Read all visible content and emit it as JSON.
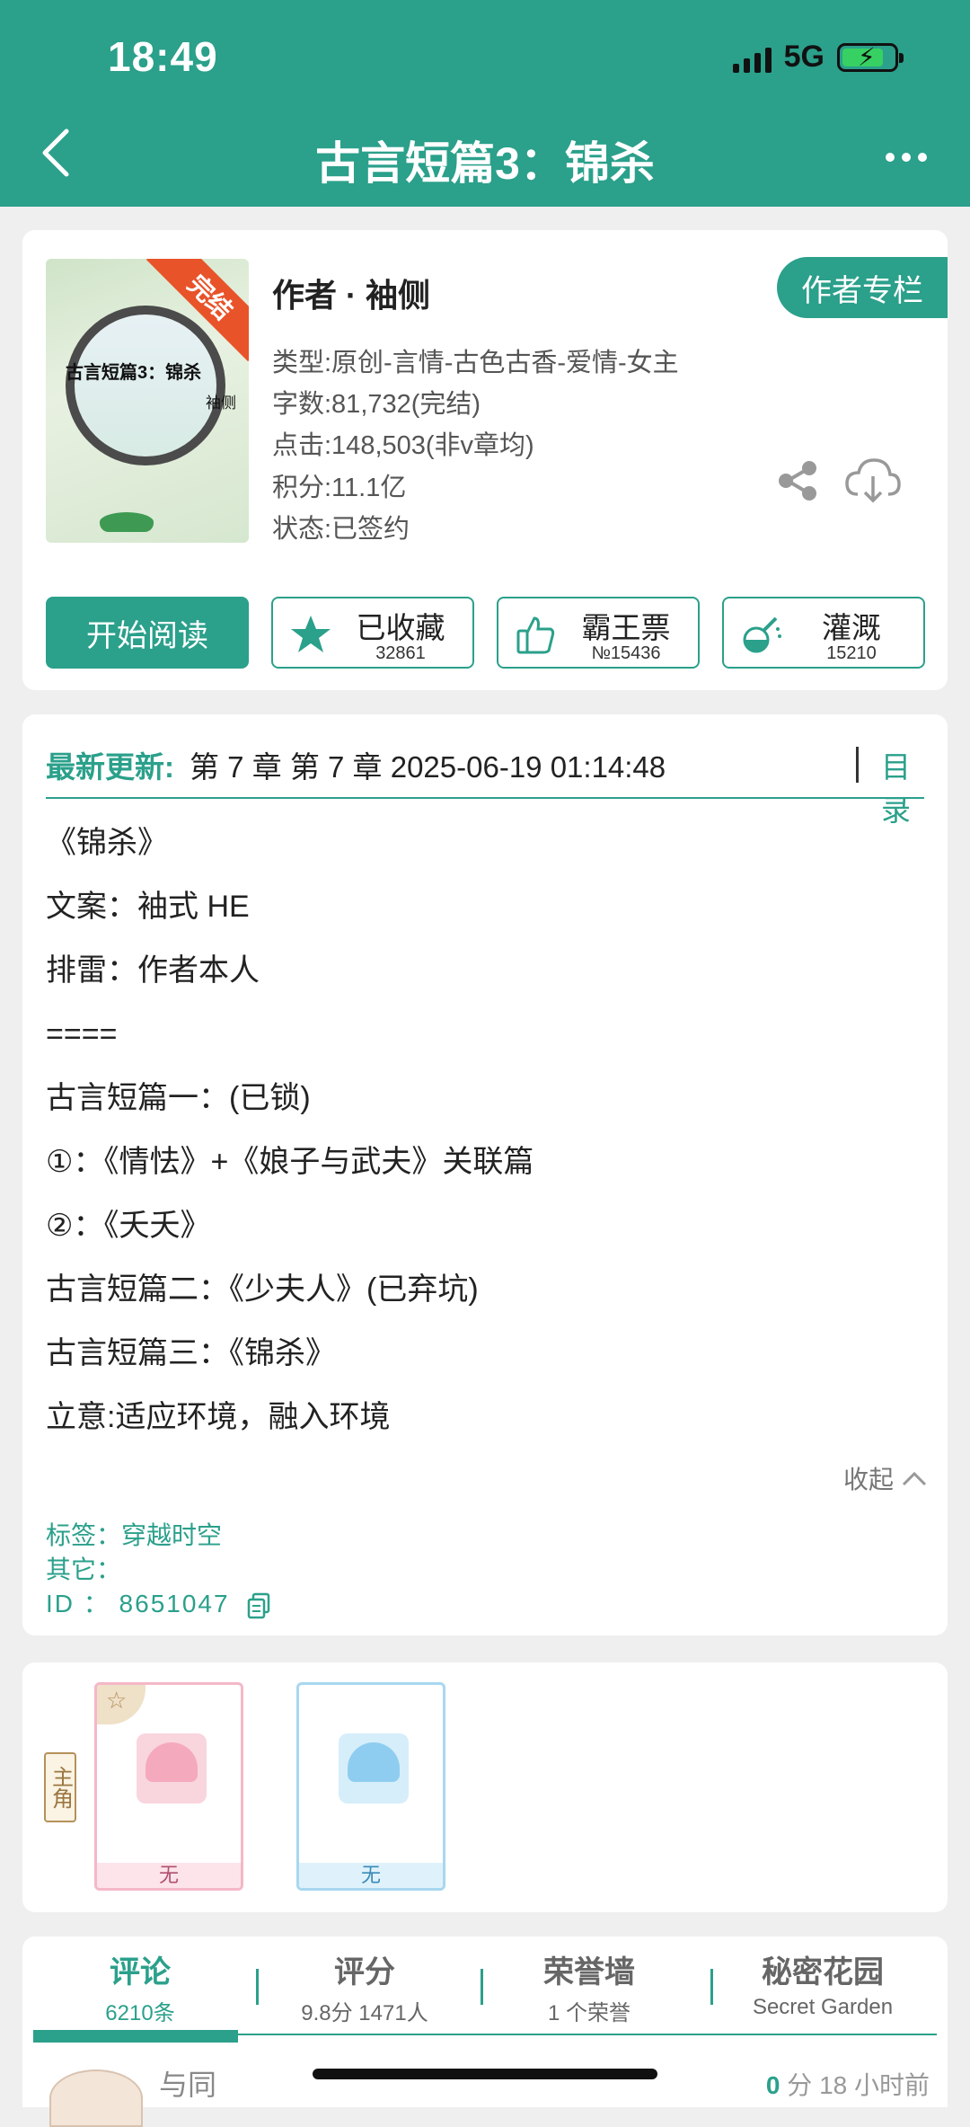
{
  "status_bar": {
    "time": "18:49",
    "network": "5G"
  },
  "nav": {
    "title": "古言短篇3：锦杀"
  },
  "book": {
    "cover_title": "古言短篇3：锦杀",
    "cover_author": "袖侧",
    "cover_ribbon": "完结",
    "author_line": "作者 · 袖侧",
    "author_column_label": "作者专栏",
    "meta": {
      "type": "类型:原创-言情-古色古香-爱情-女主",
      "words": "字数:81,732(完结)",
      "clicks": "点击:148,503(非v章均)",
      "points": "积分:11.1亿",
      "status": "状态:已签约"
    }
  },
  "actions": {
    "read_label": "开始阅读",
    "favorite": {
      "label": "已收藏",
      "count": "32861"
    },
    "vote": {
      "label": "霸王票",
      "count": "№15436"
    },
    "water": {
      "label": "灌溉",
      "count": "15210"
    }
  },
  "update": {
    "label": "最新更新:",
    "text": "第 7 章 第 7 章 2025-06-19 01:14:48",
    "toc_label": "目录"
  },
  "description": [
    "《锦杀》",
    "文案：袖式 HE",
    "排雷：作者本人",
    "====",
    "古言短篇一：(已锁)",
    "①：《情怯》+《娘子与武夫》关联篇",
    "②：《夭夭》",
    "古言短篇二：《少夫人》(已弃坑)",
    "古言短篇三：《锦杀》",
    "立意:适应环境，融入环境"
  ],
  "collapse_label": "收起",
  "tags": "标签：穿越时空",
  "other": "其它：",
  "id_line": "ID ： 8651047",
  "characters": {
    "role_label": "主角",
    "items": [
      {
        "name": "无"
      },
      {
        "name": "无"
      }
    ]
  },
  "tabs": [
    {
      "label": "评论",
      "sub": "6210条"
    },
    {
      "label": "评分",
      "sub": "9.8分 1471人"
    },
    {
      "label": "荣誉墙",
      "sub": "1 个荣誉"
    },
    {
      "label": "秘密花园",
      "sub": "Secret Garden"
    }
  ],
  "comment_preview": {
    "name": "与同",
    "score": "0",
    "score_unit": "分",
    "time": "18 小时前"
  },
  "colors": {
    "accent": "#2ba08b",
    "ribbon": "#e8532a"
  },
  "icons": [
    "back-arrow-icon",
    "more-dots-icon",
    "share-icon",
    "download-icon",
    "star-icon",
    "thumbs-up-icon",
    "watering-icon",
    "copy-icon",
    "chevron-up-icon"
  ]
}
